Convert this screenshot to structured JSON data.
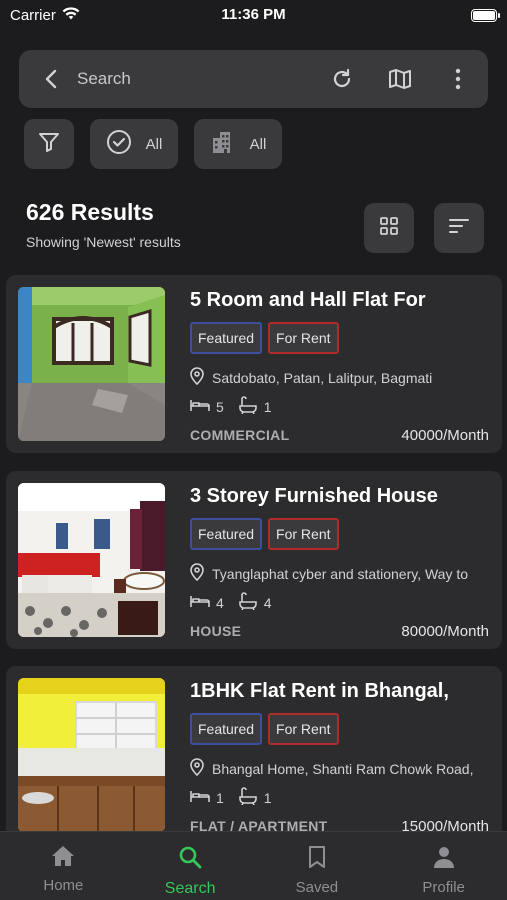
{
  "status": {
    "carrier": "Carrier",
    "time": "11:36 PM"
  },
  "search": {
    "placeholder": "Search"
  },
  "filters": {
    "status_label": "All",
    "type_label": "All"
  },
  "results": {
    "title": "626 Results",
    "subtitle": "Showing 'Newest' results"
  },
  "listings": [
    {
      "title": "5 Room and Hall Flat For",
      "featured": "Featured",
      "rent": "For Rent",
      "location": "Satdobato, Patan, Lalitpur, Bagmati",
      "beds": "5",
      "baths": "1",
      "category": "COMMERCIAL",
      "price": "40000/Month"
    },
    {
      "title": "3 Storey Furnished House",
      "featured": "Featured",
      "rent": "For Rent",
      "location": "Tyanglaphat cyber and stationery, Way to",
      "beds": "4",
      "baths": "4",
      "category": "HOUSE",
      "price": "80000/Month"
    },
    {
      "title": "1BHK Flat Rent in Bhangal,",
      "featured": "Featured",
      "rent": "For Rent",
      "location": "Bhangal Home, Shanti Ram Chowk Road,",
      "beds": "1",
      "baths": "1",
      "category": "FLAT / APARTMENT",
      "price": "15000/Month"
    }
  ],
  "tabs": [
    {
      "label": "Home",
      "icon": "home-icon"
    },
    {
      "label": "Search",
      "icon": "search-icon"
    },
    {
      "label": "Saved",
      "icon": "bookmark-icon"
    },
    {
      "label": "Profile",
      "icon": "person-icon"
    }
  ],
  "colors": {
    "accent": "#34c759",
    "featured_border": "#3b4fa0",
    "rent_border": "#b22a2a",
    "background": "#1c1c1e",
    "card": "#2c2c2e"
  }
}
